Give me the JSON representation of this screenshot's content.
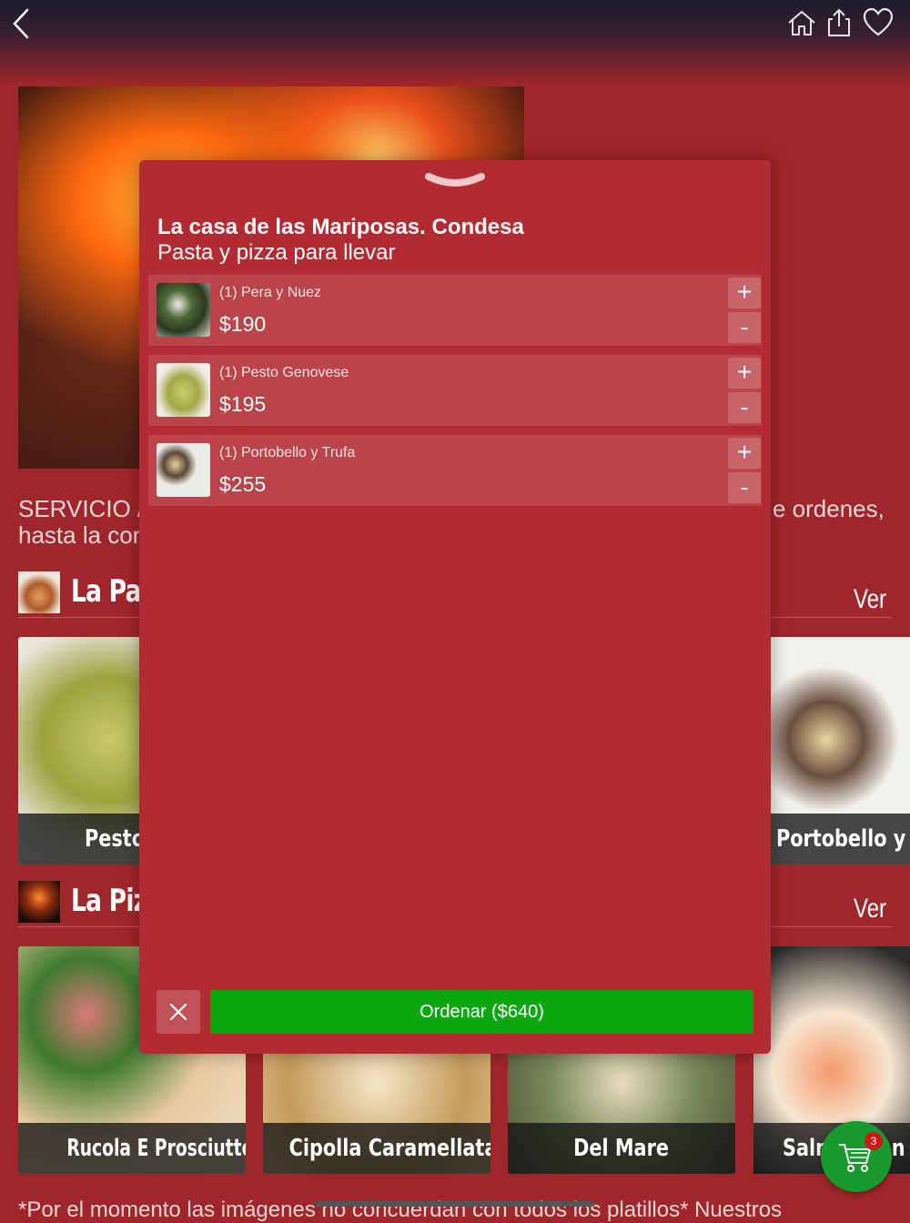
{
  "background": {
    "intro_text_line1_left": "SERVICIO /",
    "intro_text_line1_right": "e ordenes,",
    "intro_text_line2_left": "hasta la con",
    "sections": [
      {
        "title": "La Pas",
        "ver_label": "Ver",
        "cards": [
          {
            "label": "Pesto Ge"
          },
          {
            "label": "Portobello y T"
          }
        ]
      },
      {
        "title": "La Piz",
        "ver_label": "Ver",
        "cards": [
          {
            "label": "Rucola E Prosciutto Crudo"
          },
          {
            "label": "Cipolla Caramellata"
          },
          {
            "label": "Del Mare"
          },
          {
            "label": "Salm"
          },
          {
            "label": "n I"
          }
        ]
      }
    ],
    "footer_note": "*Por el momento las imágenes no concuerdan con todos los platillos* Nuestros",
    "cart_badge_count": "3"
  },
  "modal": {
    "title": "La casa de las Mariposas. Condesa",
    "subtitle": "Pasta y pizza para llevar",
    "items": [
      {
        "name": "(1) Pera y Nuez",
        "price": "$190",
        "plus": "+",
        "minus": "-"
      },
      {
        "name": "(1) Pesto Genovese",
        "price": "$195",
        "plus": "+",
        "minus": "-"
      },
      {
        "name": "(1) Portobello y Trufa",
        "price": "$255",
        "plus": "+",
        "minus": "-"
      }
    ],
    "order_button_label": "Ordenar ($640)"
  },
  "colors": {
    "background_red": "#a1262b",
    "modal_red": "#b22b32",
    "order_green": "#0aa70f",
    "cart_green": "#1a9a2e"
  },
  "icons": [
    "back-chevron-icon",
    "home-icon",
    "share-icon",
    "heart-icon",
    "grabber-icon",
    "close-icon",
    "cart-icon"
  ]
}
